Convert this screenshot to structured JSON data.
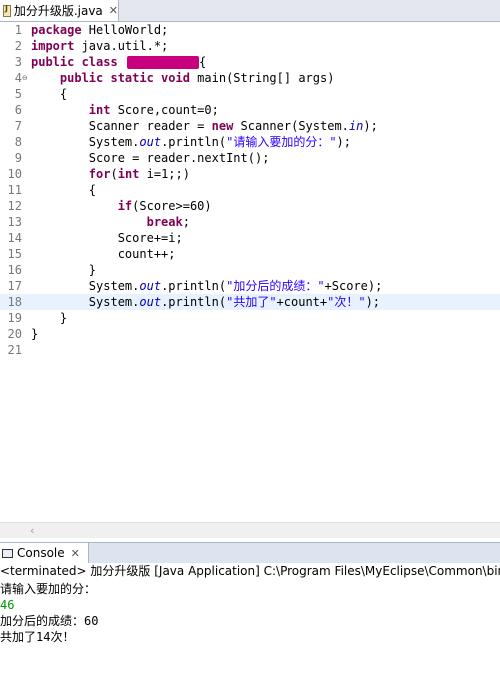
{
  "editor_tab": {
    "filename": "加分升级版.java",
    "close": "✕"
  },
  "lines": [
    {
      "n": "1"
    },
    {
      "n": "2"
    },
    {
      "n": "3"
    },
    {
      "n": "4"
    },
    {
      "n": "5"
    },
    {
      "n": "6"
    },
    {
      "n": "7"
    },
    {
      "n": "8"
    },
    {
      "n": "9"
    },
    {
      "n": "10"
    },
    {
      "n": "11"
    },
    {
      "n": "12"
    },
    {
      "n": "13"
    },
    {
      "n": "14"
    },
    {
      "n": "15"
    },
    {
      "n": "16"
    },
    {
      "n": "17"
    },
    {
      "n": "18"
    },
    {
      "n": "19"
    },
    {
      "n": "20"
    },
    {
      "n": "21"
    }
  ],
  "code": {
    "l1": {
      "kw": "package",
      "rest": " HelloWorld;"
    },
    "l2": {
      "kw": "import",
      "rest": " java.util.*;"
    },
    "l3": {
      "kw": "public class",
      "rest": "{"
    },
    "l4": {
      "kw": "public static void",
      "rest": " main(String[] args)"
    },
    "l5": "{",
    "l6": {
      "kw": "int",
      "rest": " Score,count=0;"
    },
    "l7": {
      "a": "Scanner reader = ",
      "kw": "new",
      "b": " Scanner(System.",
      "st": "in",
      "c": ");"
    },
    "l8": {
      "a": "System.",
      "st": "out",
      "b": ".println(",
      "str": "\"请输入要加的分：\"",
      "c": ");"
    },
    "l9": "Score = reader.nextInt();",
    "l10": {
      "kw1": "for",
      "a": "(",
      "kw2": "int",
      "b": " i=1;;)"
    },
    "l11": "{",
    "l12": {
      "kw": "if",
      "rest": "(Score>=60)"
    },
    "l13": {
      "kw": "break",
      "rest": ";"
    },
    "l14": "Score+=i;",
    "l15": "count++;",
    "l16": "}",
    "l17": {
      "a": "System.",
      "st": "out",
      "b": ".println(",
      "str": "\"加分后的成绩：\"",
      "c": "+Score);"
    },
    "l18": {
      "a": "System.",
      "st": "out",
      "b": ".println(",
      "str1": "\"共加了\"",
      "m": "+count+",
      "str2": "\"次！\"",
      "c": ");"
    },
    "l19": "}",
    "l20": "}"
  },
  "hscroll": {
    "left_arrow": "‹"
  },
  "console": {
    "tab_label": "Console",
    "close": "✕",
    "status": "<terminated> 加分升级版 [Java Application] C:\\Program Files\\MyEclipse\\Common\\binary\\com.sun.java.jdk",
    "output": [
      {
        "text": "请输入要加的分：",
        "input": false
      },
      {
        "text": "46",
        "input": true
      },
      {
        "text": "加分后的成绩：60",
        "input": false
      },
      {
        "text": "共加了14次！",
        "input": false
      }
    ]
  },
  "colors": {
    "keyword": "#7f0055",
    "string": "#2a00ff",
    "static_field": "#0000c0",
    "highlight_line": "#e8f2fe",
    "console_input": "#009900"
  }
}
